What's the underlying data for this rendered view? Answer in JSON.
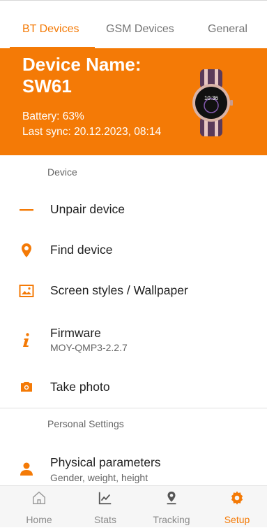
{
  "colors": {
    "accent": "#f47a06",
    "text": "#1f1f1f",
    "muted": "#666666"
  },
  "tabs": [
    {
      "label": "BT Devices",
      "active": true
    },
    {
      "label": "GSM Devices",
      "active": false
    },
    {
      "label": "General",
      "active": false
    }
  ],
  "device": {
    "name": "Device Name: SW61",
    "battery": "Battery: 63%",
    "last_sync": "Last sync: 20.12.2023, 08:14",
    "watch_time": "10:36",
    "watch_icon": "smartwatch-image"
  },
  "sections": {
    "device_header": "Device",
    "personal_header": "Personal Settings"
  },
  "items": {
    "unpair": {
      "label": "Unpair device",
      "icon": "dash-icon"
    },
    "find": {
      "label": "Find device",
      "icon": "location-pin-icon"
    },
    "wallpaper": {
      "label": "Screen styles / Wallpaper",
      "icon": "image-icon"
    },
    "firmware": {
      "label": "Firmware",
      "sub": "MOY-QMP3-2.2.7",
      "icon": "info-icon"
    },
    "photo": {
      "label": "Take photo",
      "icon": "camera-icon"
    },
    "physical": {
      "label": "Physical parameters",
      "sub": "Gender, weight, height",
      "icon": "person-icon"
    }
  },
  "bottom_nav": [
    {
      "label": "Home",
      "icon": "home-icon",
      "active": false
    },
    {
      "label": "Stats",
      "icon": "chart-icon",
      "active": false
    },
    {
      "label": "Tracking",
      "icon": "location-pin-icon",
      "active": false
    },
    {
      "label": "Setup",
      "icon": "gear-icon",
      "active": true
    }
  ]
}
